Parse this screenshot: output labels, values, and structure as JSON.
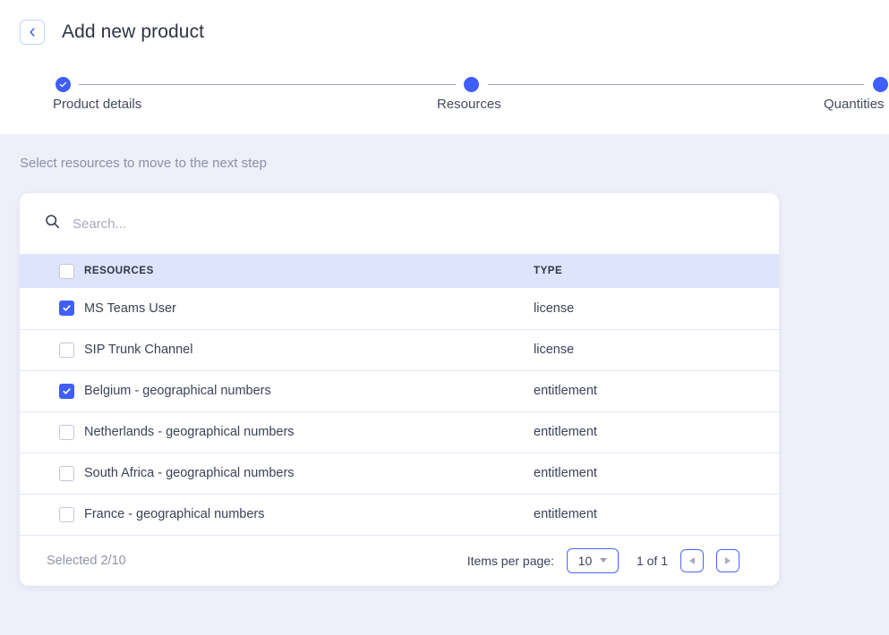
{
  "header": {
    "title": "Add new product",
    "back_icon": "chevron-left-icon"
  },
  "stepper": {
    "steps": [
      {
        "label": "Product details",
        "state": "completed",
        "icon": "check-icon"
      },
      {
        "label": "Resources",
        "state": "current",
        "icon": "dot-icon"
      },
      {
        "label": "Quantities",
        "state": "upcoming",
        "icon": "dot-icon"
      }
    ]
  },
  "content": {
    "subtitle": "Select resources to move to the next step"
  },
  "search": {
    "icon": "search-icon",
    "value": "",
    "placeholder": "Search..."
  },
  "table": {
    "columns": [
      {
        "key": "select",
        "label": ""
      },
      {
        "key": "resources",
        "label": "RESOURCES"
      },
      {
        "key": "type",
        "label": "TYPE"
      }
    ],
    "select_all_checked": false,
    "rows": [
      {
        "name": "MS Teams User",
        "type": "license",
        "checked": true
      },
      {
        "name": "SIP Trunk Channel",
        "type": "license",
        "checked": false
      },
      {
        "name": "Belgium - geographical numbers",
        "type": "entitlement",
        "checked": true
      },
      {
        "name": "Netherlands - geographical numbers",
        "type": "entitlement",
        "checked": false
      },
      {
        "name": "South Africa - geographical numbers",
        "type": "entitlement",
        "checked": false
      },
      {
        "name": "France - geographical numbers",
        "type": "entitlement",
        "checked": false
      }
    ]
  },
  "footer": {
    "selected_text": "Selected 2/10",
    "items_per_page_label": "Items per page:",
    "items_per_page_value": "10",
    "page_range": "1 of 1",
    "prev_icon": "arrow-left-icon",
    "next_icon": "arrow-right-icon"
  },
  "colors": {
    "accent": "#3f5efb",
    "page_background": "#eeeff8",
    "card_background": "#ffffff",
    "table_header_background": "#dde4fb",
    "muted_text": "#8b90a8"
  }
}
